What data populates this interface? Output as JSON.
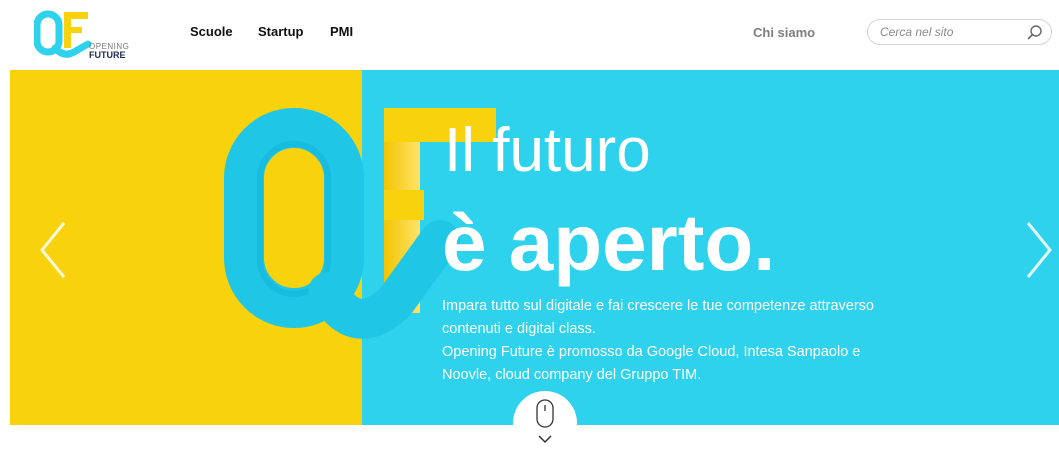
{
  "brand": {
    "logo_line1": "OPENING",
    "logo_line2": "FUTURE",
    "colors": {
      "yellow": "#f8d20c",
      "cyan": "#2ed2ec",
      "dark_blue": "#1a2a55"
    }
  },
  "nav": {
    "items": [
      {
        "label": "Scuole"
      },
      {
        "label": "Startup"
      },
      {
        "label": "PMI"
      }
    ],
    "about_label": "Chi siamo"
  },
  "search": {
    "placeholder": "Cerca nel sito",
    "value": "",
    "icon": "search-icon"
  },
  "hero": {
    "headline_line1": "Il futuro",
    "headline_line2": "è aperto.",
    "paragraph1": "Impara tutto sul digitale e fai crescere le tue competenze attraverso contenuti e digital class.",
    "paragraph2": "Opening Future è promosso da Google Cloud, Intesa Sanpaolo e Noovle, cloud company del Gruppo TIM.",
    "prev_icon": "chevron-left-icon",
    "next_icon": "chevron-right-icon",
    "scroll_icon": "mouse-scroll-icon"
  }
}
